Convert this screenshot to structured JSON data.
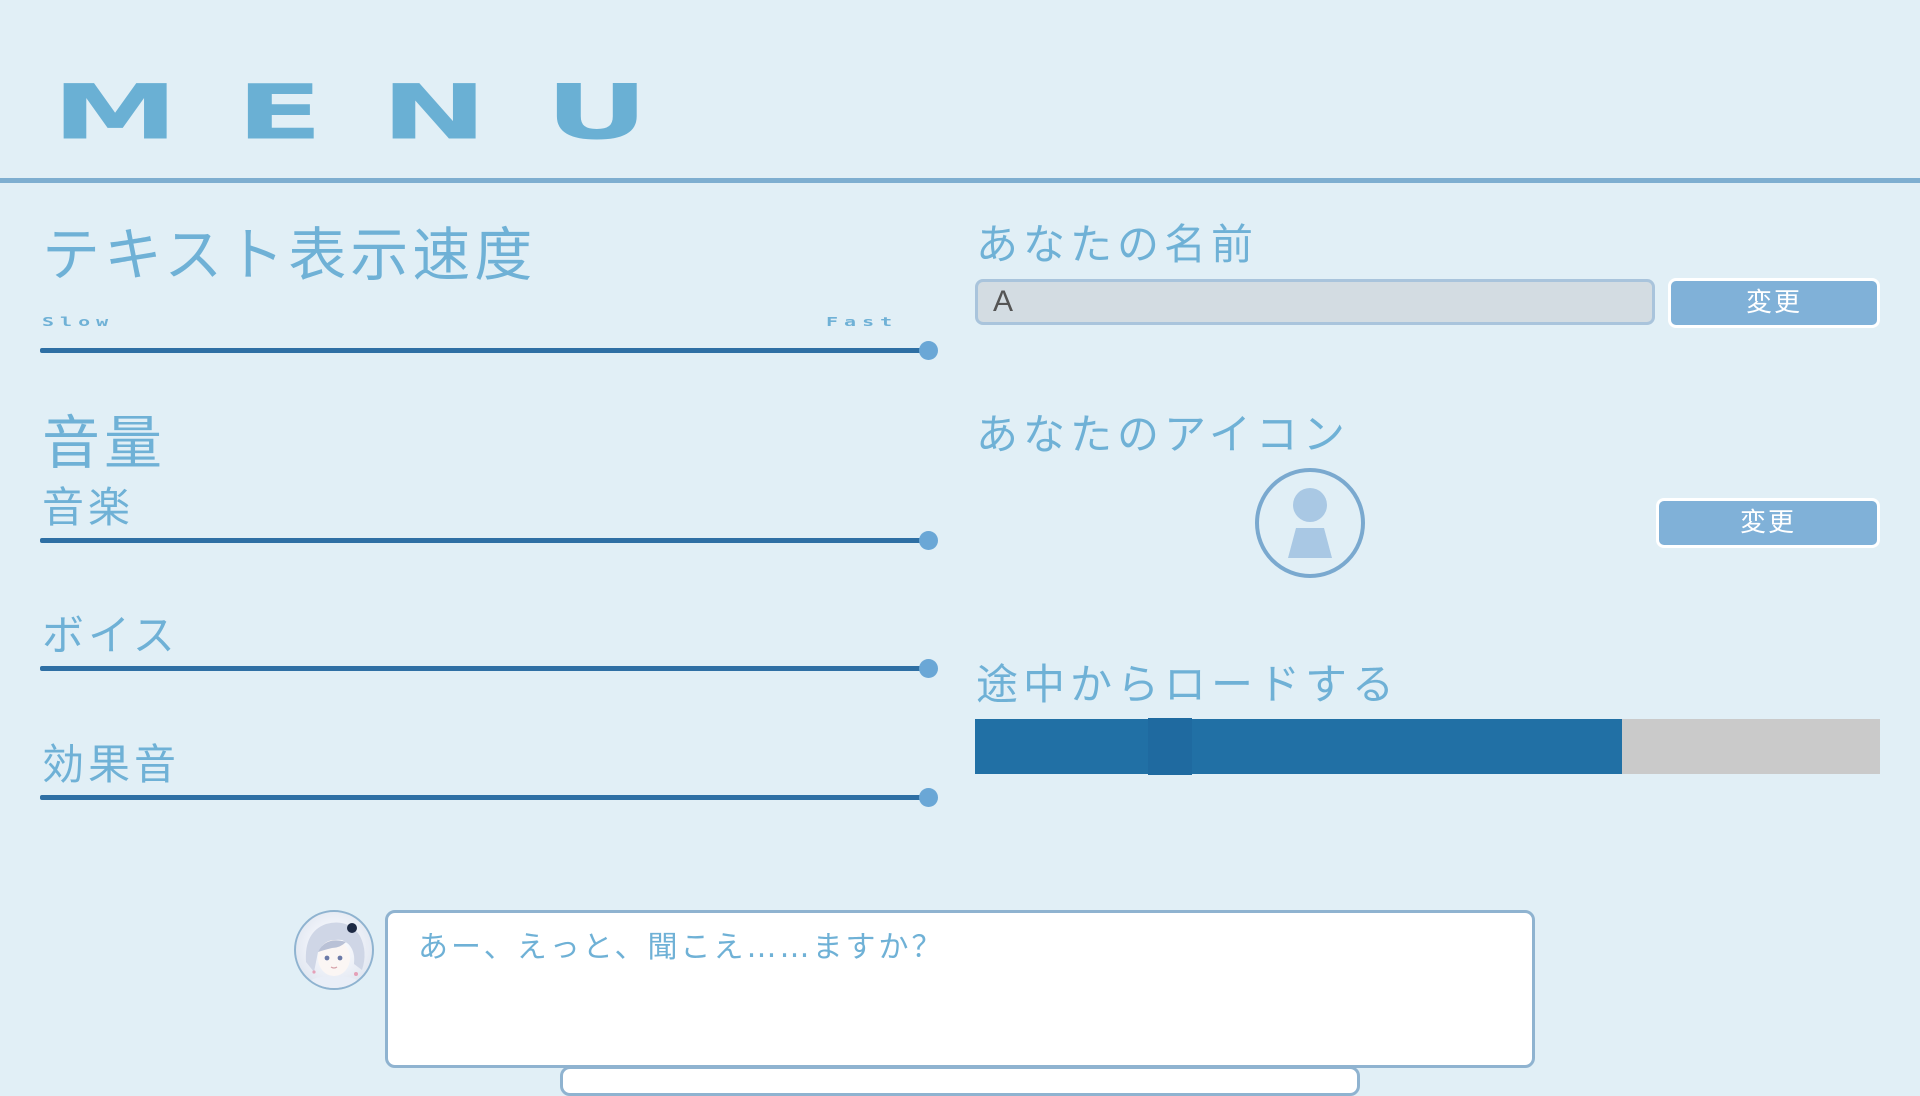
{
  "header": {
    "title": "MENU"
  },
  "settings": {
    "text_speed": {
      "heading": "テキスト表示速度",
      "slow_label": "Slow",
      "fast_label": "Fast",
      "value": 1.0
    },
    "volume": {
      "heading": "音量",
      "music": {
        "label": "音楽",
        "value": 1.0
      },
      "voice": {
        "label": "ボイス",
        "value": 1.0
      },
      "sfx": {
        "label": "効果音",
        "value": 1.0
      }
    }
  },
  "profile": {
    "name_heading": "あなたの名前",
    "name_value": "A",
    "name_change_label": "変更",
    "icon_heading": "あなたのアイコン",
    "icon_name": "user-silhouette-icon",
    "icon_change_label": "変更"
  },
  "load": {
    "heading": "途中からロードする",
    "progress": 0.715,
    "handle_position": 0.215
  },
  "dialogue": {
    "text": "あー、えっと、聞こえ……ますか？",
    "speaker_icon": "character-portrait"
  },
  "colors": {
    "background": "#e1eff6",
    "accent_text": "#6fb1d6",
    "slider_track": "#2e6fa4",
    "slider_knob": "#6aa7d6",
    "button": "#80b1d8",
    "progress_fill": "#2170a5",
    "progress_empty": "#cacaca"
  }
}
